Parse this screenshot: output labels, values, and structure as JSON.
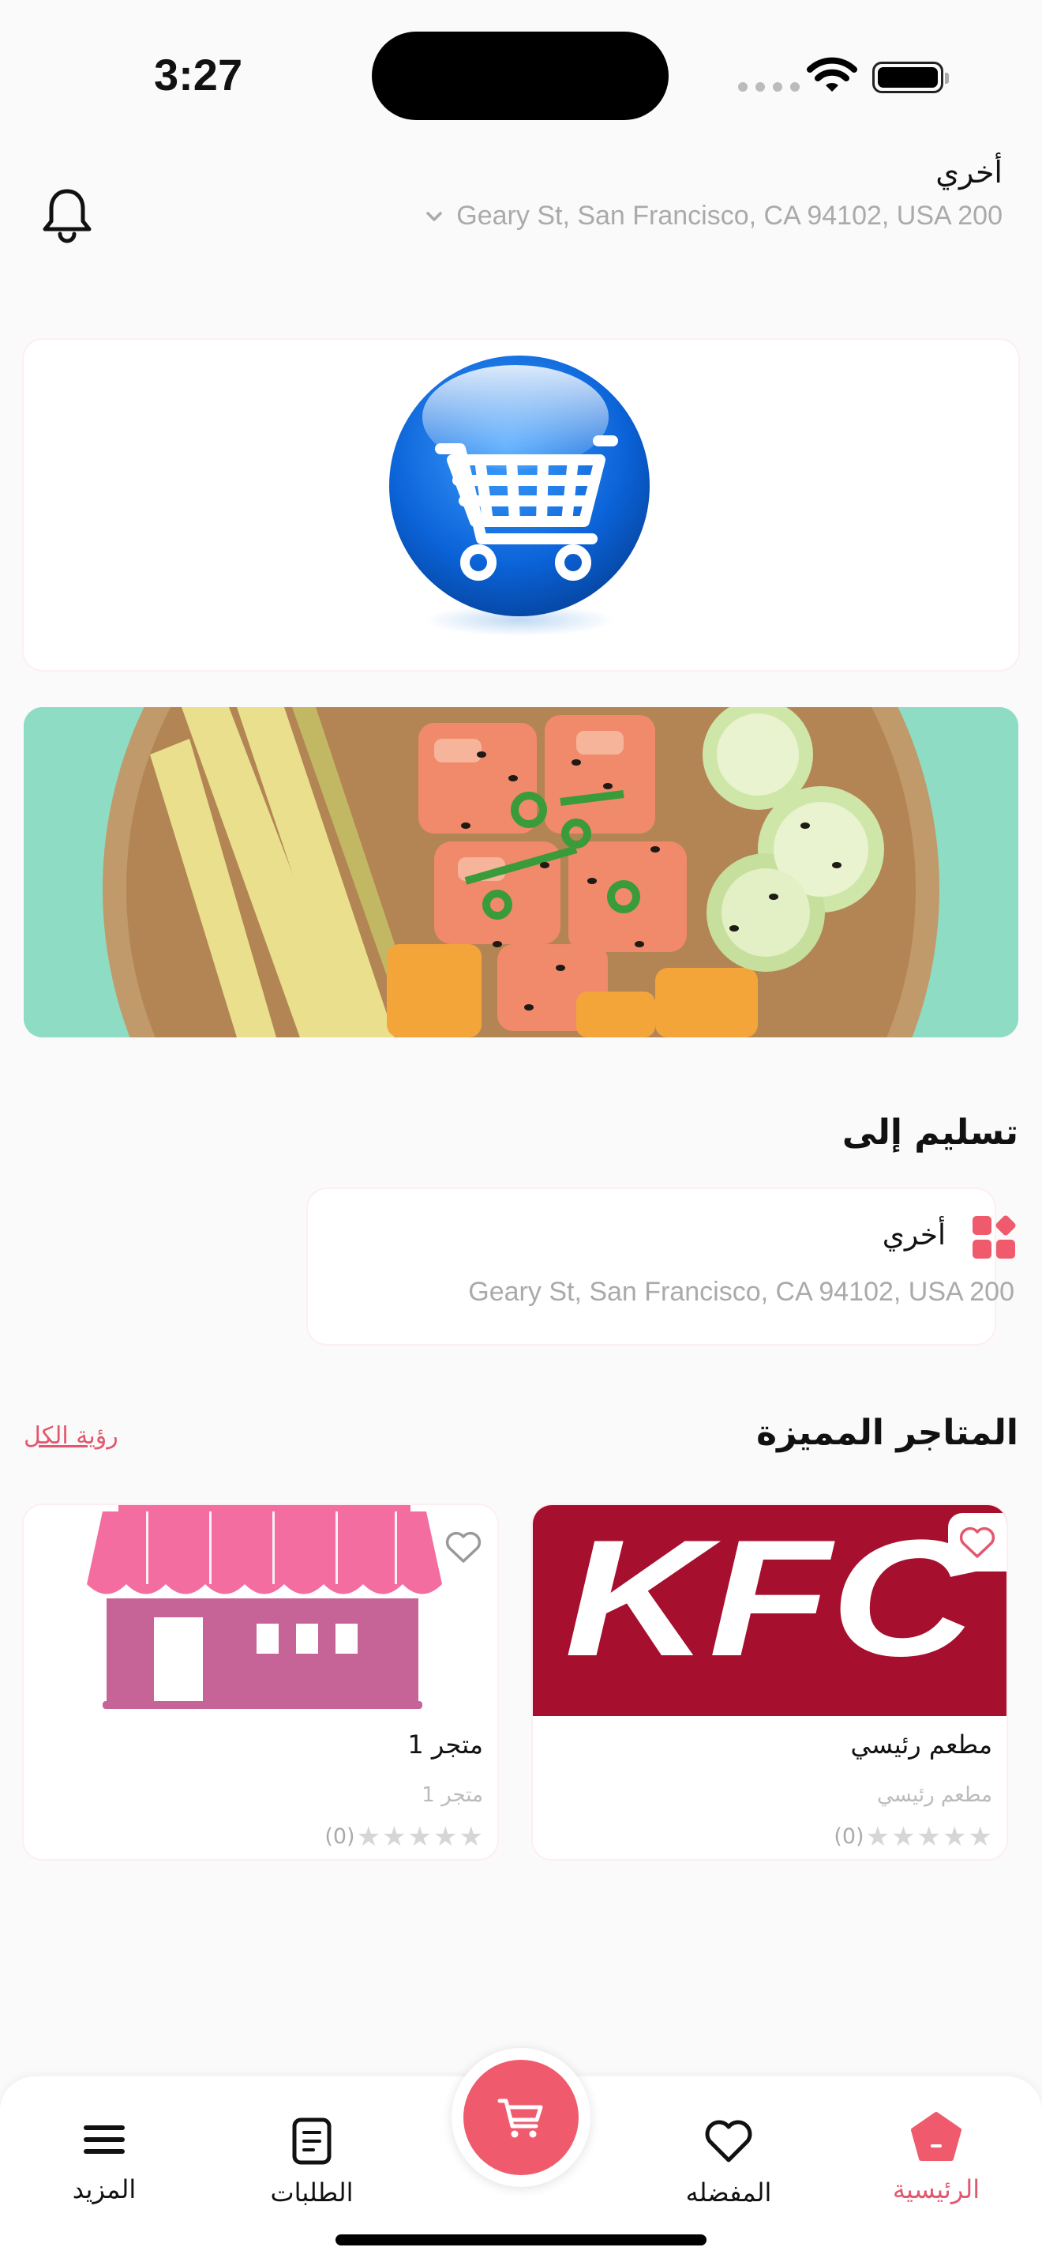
{
  "status_bar": {
    "time": "3:27"
  },
  "header": {
    "location_label": "أخري",
    "address": "Geary St, San Francisco, CA 94102, USA 200"
  },
  "delivery": {
    "title": "تسليم إلى",
    "location_label": "أخري",
    "address": "Geary St, San Francisco, CA 94102, USA 200"
  },
  "featured": {
    "title": "المتاجر المميزة",
    "see_all": "رؤية الكل",
    "stores": [
      {
        "logo_text": "KFC",
        "name": "مطعم رئيسي",
        "subtitle": "مطعم رئيسي",
        "rating_count": "(0)",
        "stars": 0
      },
      {
        "name": "متجر 1",
        "subtitle": "متجر 1",
        "rating_count": "(0)",
        "stars": 0
      }
    ]
  },
  "bottom_nav": {
    "items": [
      {
        "label": "الرئيسية",
        "icon": "home-icon",
        "active": true
      },
      {
        "label": "المفضله",
        "icon": "heart-icon"
      },
      {
        "label": "الطلبات",
        "icon": "orders-icon"
      },
      {
        "label": "المزيد",
        "icon": "menu-icon"
      }
    ],
    "cart_icon": "cart-icon"
  },
  "colors": {
    "accent": "#ef5b6d",
    "kfc_red": "#a60f2d",
    "store_pink": "#f46da0",
    "store_mauve": "#c76497"
  }
}
